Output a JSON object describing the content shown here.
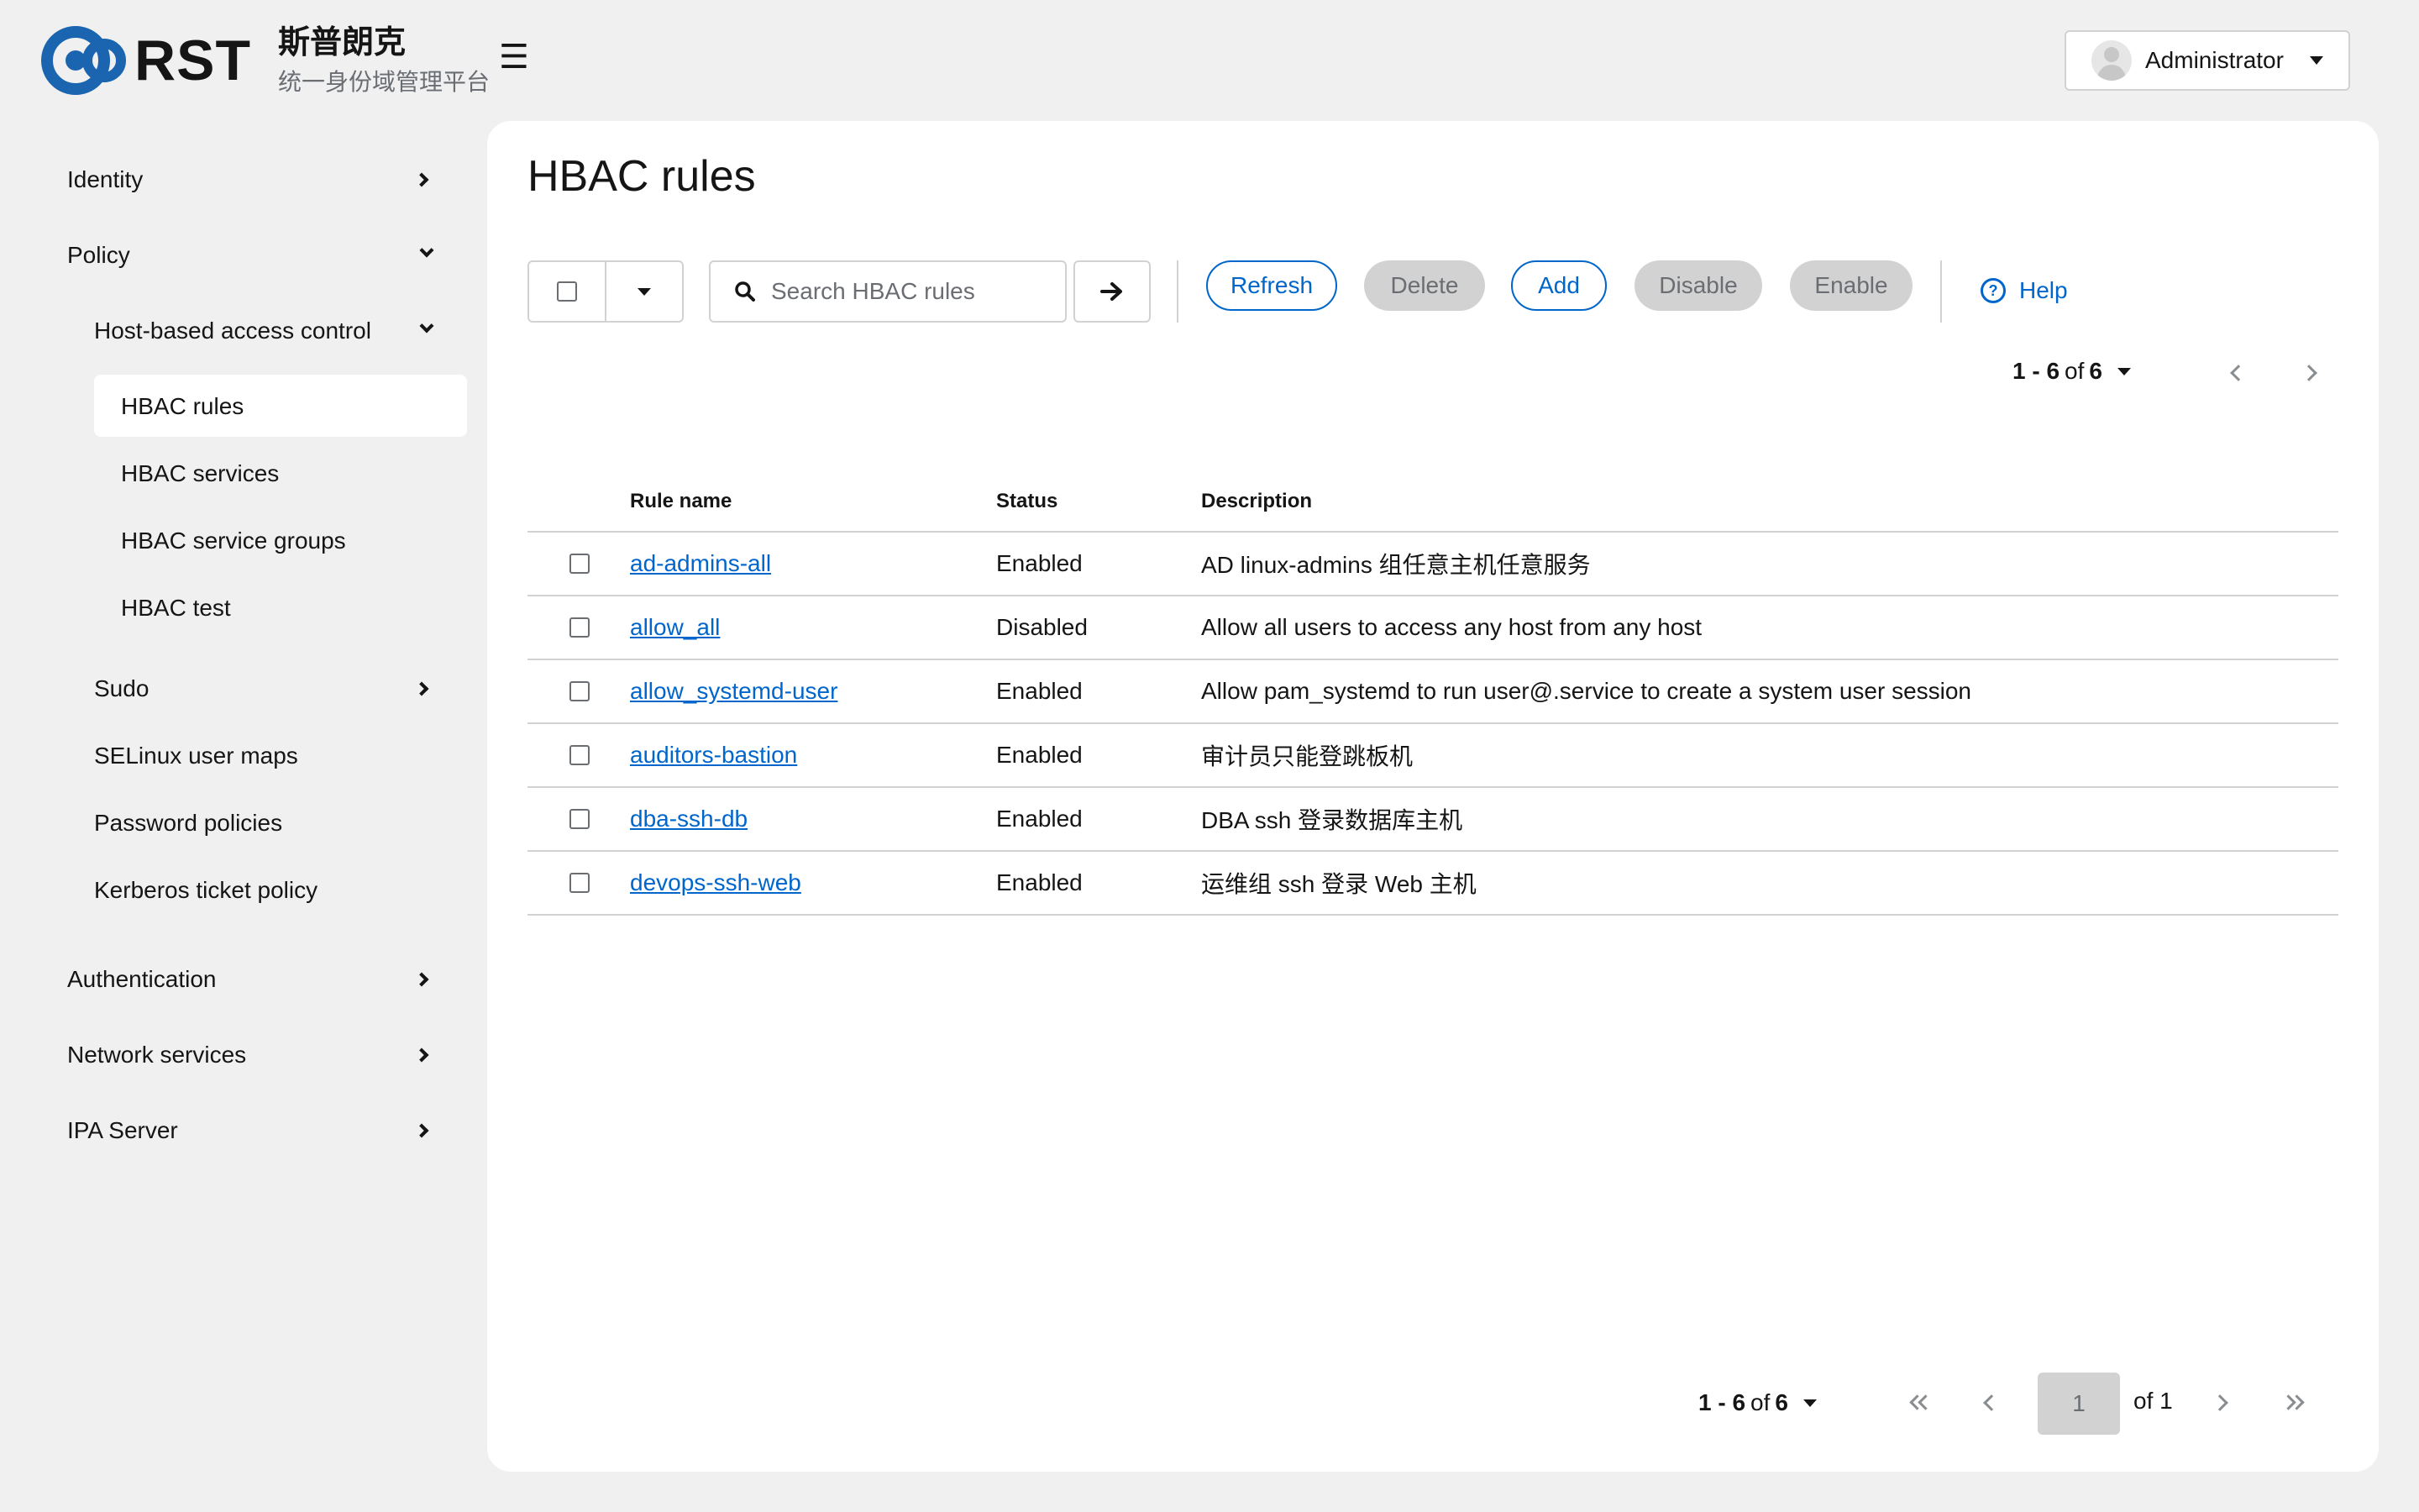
{
  "brand": {
    "logo_text": "RST",
    "name_cn": "斯普朗克",
    "subtitle": "统一身份域管理平台",
    "logo_color": "#1a64b0"
  },
  "header": {
    "menu_icon": "☰",
    "user": {
      "name": "Administrator",
      "avatar_icon": "user-avatar-icon"
    }
  },
  "sidebar": {
    "identity": "Identity",
    "policy": "Policy",
    "hbac_group": "Host-based access control",
    "hbac_rules": "HBAC rules",
    "hbac_services": "HBAC services",
    "hbac_service_groups": "HBAC service groups",
    "hbac_test": "HBAC test",
    "sudo": "Sudo",
    "selinux": "SELinux user maps",
    "password_policies": "Password policies",
    "kerberos": "Kerberos ticket policy",
    "authentication": "Authentication",
    "network_services": "Network services",
    "ipa_server": "IPA Server"
  },
  "main": {
    "title": "HBAC rules",
    "search_placeholder": "Search HBAC rules",
    "buttons": {
      "refresh": "Refresh",
      "delete": "Delete",
      "add": "Add",
      "disable": "Disable",
      "enable": "Enable",
      "help": "Help"
    },
    "pagination": {
      "range": "1 - 6",
      "of_word": "of",
      "total": "6",
      "current_page": "1",
      "of_pages": "of 1"
    },
    "columns": {
      "name": "Rule name",
      "status": "Status",
      "description": "Description"
    },
    "rows": [
      {
        "name": "ad-admins-all",
        "status": "Enabled",
        "description": "AD linux-admins 组任意主机任意服务"
      },
      {
        "name": "allow_all",
        "status": "Disabled",
        "description": "Allow all users to access any host from any host"
      },
      {
        "name": "allow_systemd-user",
        "status": "Enabled",
        "description": "Allow pam_systemd to run user@.service to create a system user session"
      },
      {
        "name": "auditors-bastion",
        "status": "Enabled",
        "description": "审计员只能登跳板机"
      },
      {
        "name": "dba-ssh-db",
        "status": "Enabled",
        "description": "DBA ssh 登录数据库主机"
      },
      {
        "name": "devops-ssh-web",
        "status": "Enabled",
        "description": "运维组 ssh 登录 Web 主机"
      }
    ]
  },
  "colors": {
    "link": "#0066cc",
    "background": "#f0f0f0",
    "panel": "#ffffff",
    "disabled_button": "#d2d2d2"
  }
}
